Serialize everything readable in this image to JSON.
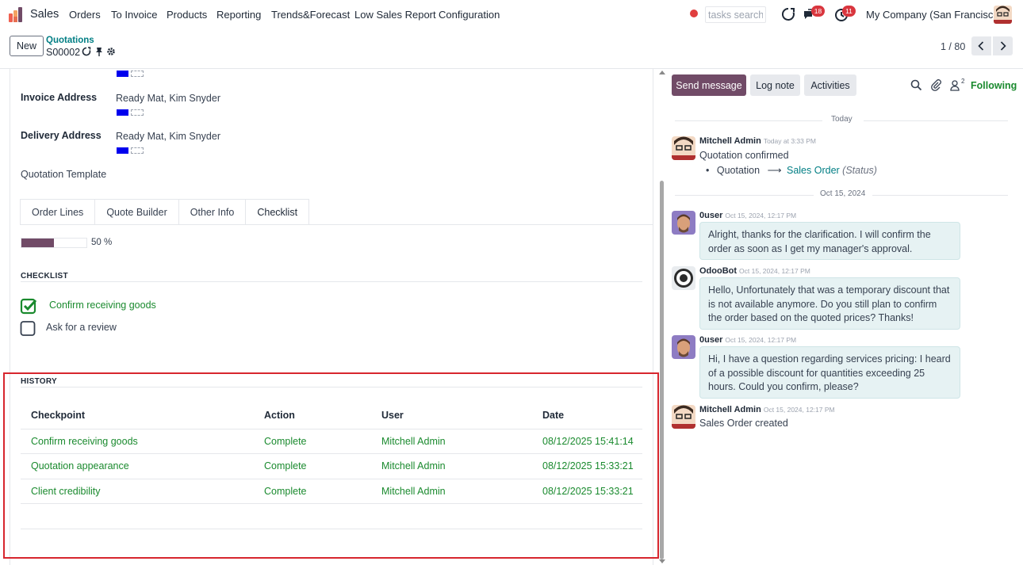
{
  "navbar": {
    "app_name": "Sales",
    "menu": [
      "Orders",
      "To Invoice",
      "Products",
      "Reporting",
      "Trends&Forecast",
      "Low Sales Report",
      "Configuration"
    ],
    "search_placeholder": "tasks search",
    "messages_badge": "18",
    "activities_badge": "11",
    "company": "My Company (San Francisco)"
  },
  "control_panel": {
    "new_label": "New",
    "breadcrumb": "Quotations",
    "record_name": "S00002",
    "pager": "1 / 80"
  },
  "form": {
    "invoice_address_label": "Invoice Address",
    "invoice_address_value": "Ready Mat, Kim Snyder",
    "delivery_address_label": "Delivery Address",
    "delivery_address_value": "Ready Mat, Kim Snyder",
    "quotation_template_label": "Quotation Template",
    "tabs": [
      "Order Lines",
      "Quote Builder",
      "Other Info",
      "Checklist"
    ],
    "active_tab": "Checklist",
    "progress": {
      "value": 50,
      "label": "50 %"
    },
    "checklist_title": "CHECKLIST",
    "checklist": [
      {
        "label": "Confirm receiving goods",
        "checked": true
      },
      {
        "label": "Ask for a review",
        "checked": false
      }
    ],
    "history_title": "HISTORY",
    "history_headers": [
      "Checkpoint",
      "Action",
      "User",
      "Date"
    ],
    "history_rows": [
      [
        "Confirm receiving goods",
        "Complete",
        "Mitchell Admin",
        "08/12/2025 15:41:14"
      ],
      [
        "Quotation appearance",
        "Complete",
        "Mitchell Admin",
        "08/12/2025 15:33:21"
      ],
      [
        "Client credibility",
        "Complete",
        "Mitchell Admin",
        "08/12/2025 15:33:21"
      ]
    ]
  },
  "chatter": {
    "send_message": "Send message",
    "log_note": "Log note",
    "activities": "Activities",
    "followers_count": "2",
    "following": "Following",
    "date_today": "Today",
    "date_older": "Oct 15, 2024",
    "messages": [
      {
        "author": "Mitchell Admin",
        "date": "Today at 3:33 PM",
        "text": "Quotation confirmed"
      },
      {
        "author": "0user",
        "date": "Oct 15, 2024, 12:17 PM",
        "text": "Alright, thanks for the clarification. I will confirm the order as soon as I get my manager's approval."
      },
      {
        "author": "OdooBot",
        "date": "Oct 15, 2024, 12:17 PM",
        "text": "Hello, Unfortunately that was a temporary discount that is not available anymore. Do you still plan to confirm the order based on the quoted prices? Thanks!"
      },
      {
        "author": "0user",
        "date": "Oct 15, 2024, 12:17 PM",
        "text": "Hi, I have a question regarding services pricing: I heard of a possible discount for quantities exceeding 25 hours. Could you confirm, please?"
      },
      {
        "author": "Mitchell Admin",
        "date": "Oct 15, 2024, 12:17 PM",
        "text": "Sales Order created"
      }
    ],
    "tracking": {
      "old": "Quotation",
      "new": "Sales Order",
      "field": "(Status)"
    }
  },
  "colors": {
    "brand": "#714b67",
    "success": "#1a8a2e",
    "link": "#017e84",
    "highlight": "#d7262e"
  }
}
